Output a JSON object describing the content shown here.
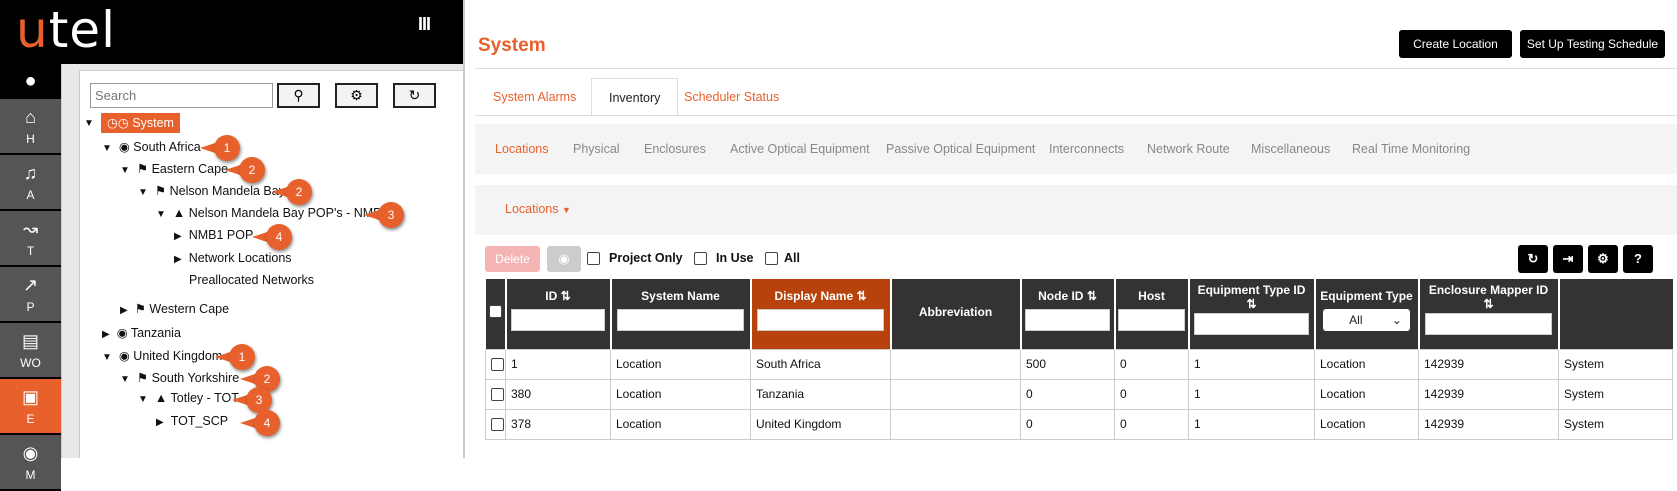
{
  "brand": {
    "u": "u",
    "tel": "tel"
  },
  "menu_icon": "bars-icon",
  "nav": [
    {
      "icon": "home-icon",
      "label": "H"
    },
    {
      "icon": "bell-icon",
      "label": "A"
    },
    {
      "icon": "chart-icon",
      "label": "T"
    },
    {
      "icon": "share-icon",
      "label": "P"
    },
    {
      "icon": "document-icon",
      "label": "WO"
    },
    {
      "icon": "chip-icon",
      "label": "E",
      "active": true
    },
    {
      "icon": "globe-icon",
      "label": "M"
    }
  ],
  "tree": {
    "search_placeholder": "Search",
    "root": "System",
    "nodes": [
      {
        "label": "South Africa",
        "badge": "1"
      },
      {
        "label": "Eastern Cape",
        "badge": "2"
      },
      {
        "label": "Nelson Mandela Bay",
        "badge": "2"
      },
      {
        "label": "Nelson Mandela Bay POP's - NMB",
        "badge": "3"
      },
      {
        "label": "NMB1 POP",
        "badge": "4"
      },
      {
        "label": "Network Locations"
      },
      {
        "label": "Preallocated Networks"
      },
      {
        "label": "Western Cape"
      },
      {
        "label": "Tanzania"
      },
      {
        "label": "United Kingdom",
        "badge": "1"
      },
      {
        "label": "South Yorkshire",
        "badge": "2"
      },
      {
        "label": "Totley - TOT",
        "badge": "3"
      },
      {
        "label": "TOT_SCP",
        "badge": "4"
      }
    ]
  },
  "header": {
    "title": "System",
    "create_location": "Create Location",
    "setup_testing": "Set Up Testing Schedule"
  },
  "tabs": [
    "System Alarms",
    "Inventory",
    "Scheduler Status"
  ],
  "subnav": [
    "Locations",
    "Physical",
    "Enclosures",
    "Active Optical Equipment",
    "Passive Optical Equipment",
    "Interconnects",
    "Network Route",
    "Miscellaneous",
    "Real Time Monitoring"
  ],
  "locations_dropdown": "Locations",
  "toolbar": {
    "delete": "Delete",
    "project_only": "Project Only",
    "in_use": "In Use",
    "all": "All"
  },
  "table": {
    "columns": [
      "ID",
      "System Name",
      "Display Name",
      "Abbreviation",
      "Node ID",
      "Host",
      "Equipment Type ID",
      "Equipment Type",
      "Enclosure Mapper ID",
      ""
    ],
    "equipment_type_filter": "All",
    "rows": [
      [
        "1",
        "Location",
        "South Africa",
        "",
        "500",
        "0",
        "1",
        "Location",
        "142939",
        "System"
      ],
      [
        "380",
        "Location",
        "Tanzania",
        "",
        "0",
        "0",
        "1",
        "Location",
        "142939",
        "System"
      ],
      [
        "378",
        "Location",
        "United Kingdom",
        "",
        "0",
        "0",
        "1",
        "Location",
        "142939",
        "System"
      ]
    ]
  },
  "colors": {
    "accent": "#e8602c",
    "sorted_header": "#b7420c",
    "header_dark": "#333333",
    "nav_bg": "#555555"
  }
}
